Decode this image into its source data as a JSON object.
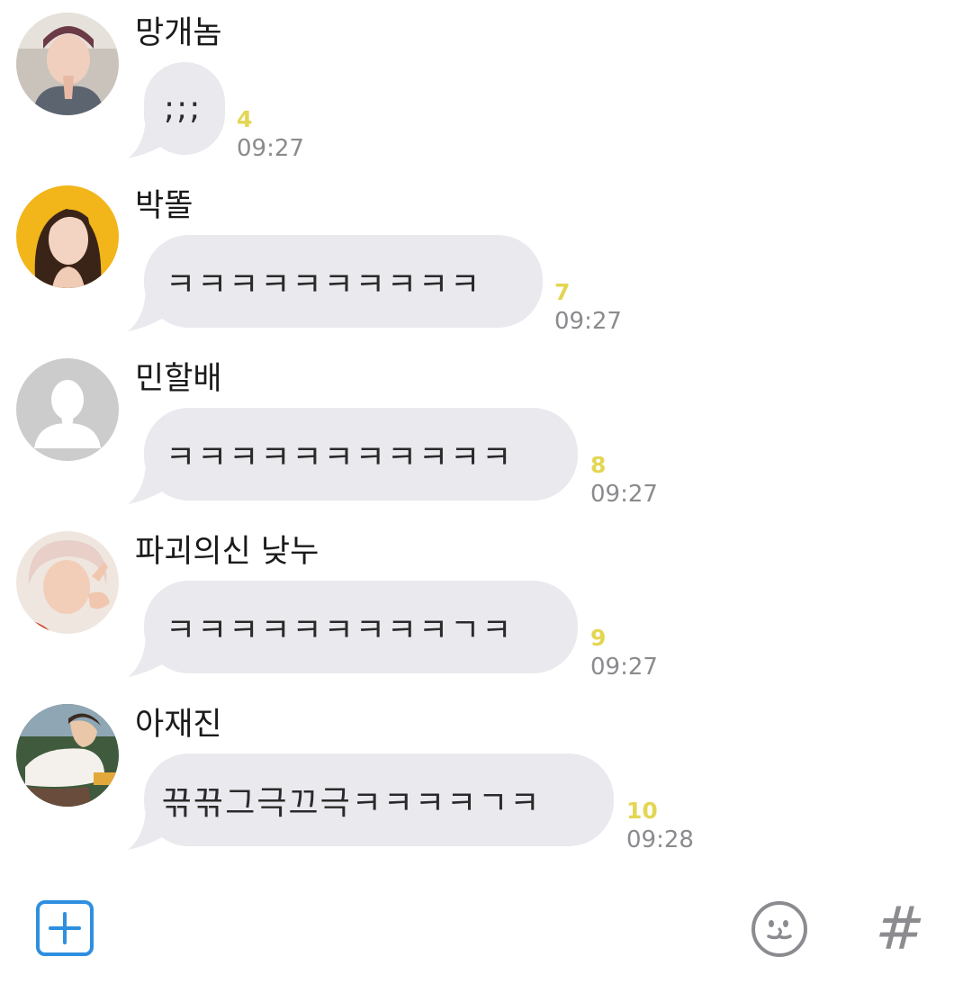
{
  "messages": [
    {
      "sender": "망개놈",
      "text": ";;;",
      "unread": "4",
      "time": "09:27"
    },
    {
      "sender": "박똘",
      "text": "ㅋㅋㅋㅋㅋㅋㅋㅋㅋㅋ",
      "unread": "7",
      "time": "09:27"
    },
    {
      "sender": "민할배",
      "text": "ㅋㅋㅋㅋㅋㅋㅋㅋㅋㅋㅋ",
      "unread": "8",
      "time": "09:27"
    },
    {
      "sender": "파괴의신 낮누",
      "text": "ㅋㅋㅋㅋㅋㅋㅋㅋㅋㄱㅋ",
      "unread": "9",
      "time": "09:27"
    },
    {
      "sender": "아재진",
      "text": "끆끆그극끄극ㅋㅋㅋㅋㄱㅋ",
      "unread": "10",
      "time": "09:28"
    }
  ],
  "input_bar": {
    "add_icon": "plus-square-icon",
    "emoji_icon": "smiley-icon",
    "hashtag_label": "#"
  },
  "colors": {
    "bubble": "#e9e9ee",
    "unread": "#e3d653",
    "time": "#8b8b8f",
    "accent": "#2e8fe0"
  }
}
